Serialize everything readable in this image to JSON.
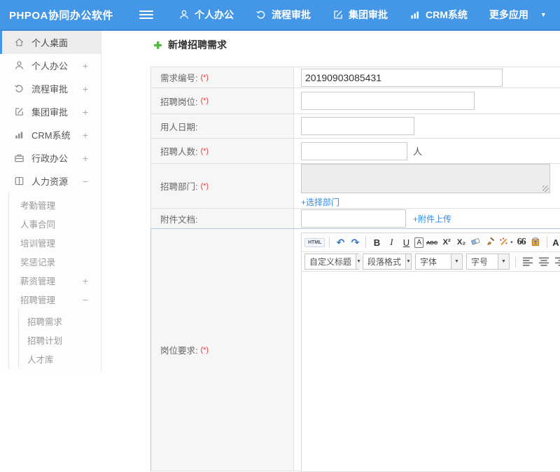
{
  "header": {
    "logo": "PHPOA协同办公软件",
    "nav": [
      {
        "label": "个人办公",
        "icon": "user-icon"
      },
      {
        "label": "流程审批",
        "icon": "workflow-icon"
      },
      {
        "label": "集团审批",
        "icon": "edit-icon"
      },
      {
        "label": "CRM系统",
        "icon": "chart-icon"
      },
      {
        "label": "更多应用",
        "icon": null,
        "caret": "▼"
      }
    ]
  },
  "sidebar": {
    "items": [
      {
        "label": "个人桌面",
        "icon": "home-icon",
        "level": 1,
        "active": true
      },
      {
        "label": "个人办公",
        "icon": "user-icon",
        "level": 1,
        "expand": "+"
      },
      {
        "label": "流程审批",
        "icon": "workflow-icon",
        "level": 1,
        "expand": "+"
      },
      {
        "label": "集团审批",
        "icon": "edit-icon",
        "level": 1,
        "expand": "+"
      },
      {
        "label": "CRM系统",
        "icon": "chart-icon",
        "level": 1,
        "expand": "+"
      },
      {
        "label": "行政办公",
        "icon": "briefcase-icon",
        "level": 1,
        "expand": "+"
      },
      {
        "label": "人力资源",
        "icon": "book-icon",
        "level": 1,
        "expand": "−"
      },
      {
        "label": "考勤管理",
        "level": 2
      },
      {
        "label": "人事合同",
        "level": 2
      },
      {
        "label": "培训管理",
        "level": 2
      },
      {
        "label": "奖惩记录",
        "level": 2
      },
      {
        "label": "薪资管理",
        "level": 2,
        "expand": "+"
      },
      {
        "label": "招聘管理",
        "level": 2,
        "expand": "−"
      },
      {
        "label": "招聘需求",
        "level": 3
      },
      {
        "label": "招聘计划",
        "level": 3
      },
      {
        "label": "人才库",
        "level": 3
      }
    ]
  },
  "main": {
    "title": "新增招聘需求",
    "required_mark": "(*)",
    "form": {
      "rows": [
        {
          "label": "需求编号:",
          "required": true,
          "type": "input",
          "value": "20190903085431"
        },
        {
          "label": "招聘岗位:",
          "required": true,
          "type": "input",
          "value": ""
        },
        {
          "label": "用人日期:",
          "required": false,
          "type": "input",
          "value": ""
        },
        {
          "label": "招聘人数:",
          "required": true,
          "type": "input-suffix",
          "value": "",
          "suffix": "人"
        },
        {
          "label": "招聘部门:",
          "required": true,
          "type": "textarea-link",
          "link": "+选择部门"
        },
        {
          "label": "附件文档:",
          "required": false,
          "type": "input-link",
          "value": "",
          "link": "+附件上传"
        },
        {
          "label": "岗位要求:",
          "required": true,
          "type": "editor"
        }
      ]
    },
    "editor": {
      "toolbar_row1": [
        {
          "name": "source-code-button",
          "glyph": "HTML"
        },
        {
          "name": "separator"
        },
        {
          "name": "undo-icon",
          "glyph": "↶"
        },
        {
          "name": "redo-icon",
          "glyph": "↷"
        },
        {
          "name": "separator"
        },
        {
          "name": "bold-button",
          "glyph": "B"
        },
        {
          "name": "italic-button",
          "glyph": "I"
        },
        {
          "name": "underline-button",
          "glyph": "U"
        },
        {
          "name": "font-border-button",
          "glyph": "A"
        },
        {
          "name": "strikethrough-button",
          "glyph": "ABC"
        },
        {
          "name": "superscript-button",
          "glyph": "X²"
        },
        {
          "name": "subscript-button",
          "glyph": "X₂"
        },
        {
          "name": "eraser-icon"
        },
        {
          "name": "format-brush-icon"
        },
        {
          "name": "autotypeset-icon",
          "caret": "▾"
        },
        {
          "name": "blockquote-button",
          "glyph": "66"
        },
        {
          "name": "paste-plain-icon"
        },
        {
          "name": "separator"
        },
        {
          "name": "font-color-button",
          "glyph": "A",
          "caret": "▾"
        },
        {
          "name": "back-color-icon"
        }
      ],
      "toolbar_row2": {
        "selects": [
          {
            "name": "custom-title-select",
            "label": "自定义标题"
          },
          {
            "name": "paragraph-format-select",
            "label": "段落格式"
          },
          {
            "name": "font-family-select",
            "label": "字体"
          },
          {
            "name": "font-size-select",
            "label": "字号"
          }
        ],
        "aligns": [
          "align-left-icon",
          "align-center-icon",
          "align-right-icon",
          "align-justify-icon"
        ]
      }
    }
  },
  "colors": {
    "header_bg": "#4497e7",
    "active_item_border": "#4497e7",
    "link_blue": "#2d8ded",
    "required_red": "#e23b3b",
    "title_plus_green": "#58b548"
  }
}
